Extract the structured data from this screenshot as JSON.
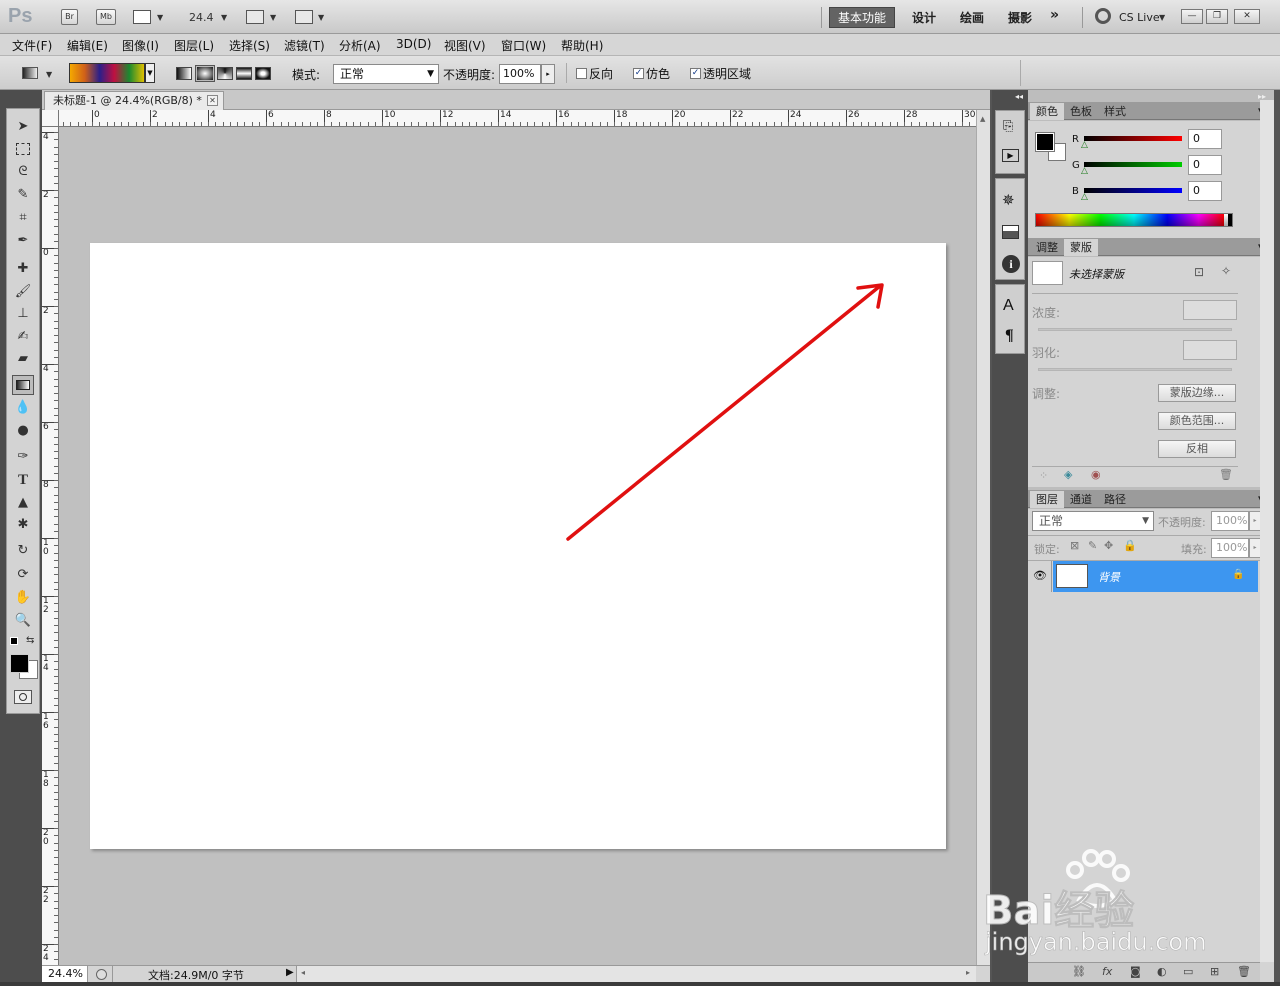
{
  "app": {
    "logo": "Ps",
    "bridge": "Br",
    "minibridge": "Mb",
    "zoom": "24.4",
    "cs_live": "CS Live"
  },
  "workspaces": [
    "基本功能",
    "设计",
    "绘画",
    "摄影",
    "»"
  ],
  "menu": [
    "文件(F)",
    "编辑(E)",
    "图像(I)",
    "图层(L)",
    "选择(S)",
    "滤镜(T)",
    "分析(A)",
    "3D(D)",
    "视图(V)",
    "窗口(W)",
    "帮助(H)"
  ],
  "options": {
    "mode_label": "模式:",
    "mode_value": "正常",
    "opacity_label": "不透明度:",
    "opacity_value": "100%",
    "reverse": "反向",
    "dither": "仿色",
    "transparency": "透明区域",
    "reverse_checked": false,
    "dither_checked": true,
    "transparency_checked": true
  },
  "document": {
    "tab_title": "未标题-1 @ 24.4%(RGB/8) *",
    "zoom_status": "24.4%",
    "doc_info": "文档:24.9M/0 字节"
  },
  "ruler": {
    "h_ticks": [
      "0",
      "2",
      "4",
      "6",
      "8",
      "10",
      "12",
      "14",
      "16",
      "18",
      "20",
      "22",
      "24",
      "26",
      "28",
      "30"
    ],
    "v_ticks": [
      "4",
      "2",
      "0",
      "2",
      "4",
      "6",
      "8",
      "1\n0",
      "1\n2",
      "1\n4",
      "1\n6",
      "1\n8",
      "2\n0",
      "2\n2",
      "2\n4"
    ]
  },
  "color_panel": {
    "tabs": [
      "颜色",
      "色板",
      "样式"
    ],
    "channels": [
      {
        "name": "R",
        "value": "0"
      },
      {
        "name": "G",
        "value": "0"
      },
      {
        "name": "B",
        "value": "0"
      }
    ]
  },
  "mask_panel": {
    "tabs": [
      "调整",
      "蒙版"
    ],
    "no_mask": "未选择蒙版",
    "density": "浓度:",
    "feather": "羽化:",
    "refine": "调整:",
    "btn_edge": "蒙版边缘...",
    "btn_range": "颜色范围...",
    "btn_invert": "反相"
  },
  "layers_panel": {
    "tabs": [
      "图层",
      "通道",
      "路径"
    ],
    "blend": "正常",
    "opacity_label": "不透明度:",
    "opacity": "100%",
    "lock_label": "锁定:",
    "fill_label": "填充:",
    "fill": "100%",
    "layer_name": "背景"
  },
  "watermark": {
    "brand": "Bai经验",
    "url": "jingyan.baidu.com"
  },
  "colors": {
    "arrow": "#e01010",
    "selected_layer": "#3d96f0"
  }
}
